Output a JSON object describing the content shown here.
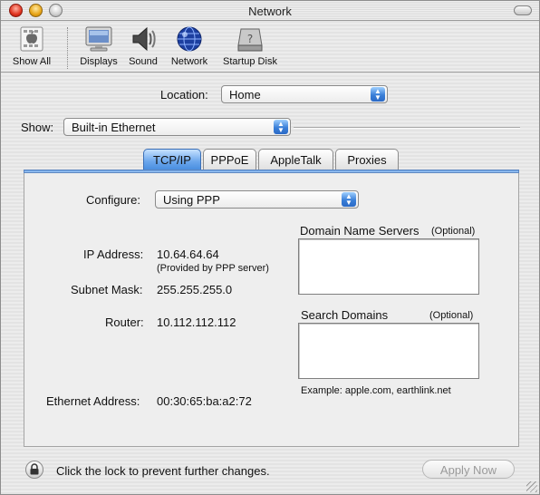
{
  "window": {
    "title": "Network"
  },
  "toolbar": {
    "items": [
      {
        "label": "Show All",
        "icon": "apple-show-all-icon"
      },
      {
        "label": "Displays",
        "icon": "display-monitor-icon"
      },
      {
        "label": "Sound",
        "icon": "speaker-icon"
      },
      {
        "label": "Network",
        "icon": "globe-icon"
      },
      {
        "label": "Startup Disk",
        "icon": "hard-disk-icon"
      }
    ]
  },
  "location": {
    "label": "Location:",
    "value": "Home"
  },
  "show": {
    "label": "Show:",
    "value": "Built-in Ethernet"
  },
  "tabs": [
    {
      "label": "TCP/IP",
      "active": true
    },
    {
      "label": "PPPoE",
      "active": false
    },
    {
      "label": "AppleTalk",
      "active": false
    },
    {
      "label": "Proxies",
      "active": false
    }
  ],
  "tcpip": {
    "configure_label": "Configure:",
    "configure_value": "Using PPP",
    "ip_label": "IP Address:",
    "ip_value": "10.64.64.64",
    "ip_note": "(Provided by PPP server)",
    "subnet_label": "Subnet Mask:",
    "subnet_value": "255.255.255.0",
    "router_label": "Router:",
    "router_value": "10.112.112.112",
    "ethernet_label": "Ethernet Address:",
    "ethernet_value": "00:30:65:ba:a2:72",
    "dns_label": "Domain Name Servers",
    "dns_optional": "(Optional)",
    "dns_value": "",
    "search_label": "Search Domains",
    "search_optional": "(Optional)",
    "search_value": "",
    "example": "Example: apple.com, earthlink.net"
  },
  "footer": {
    "lock_text": "Click the lock to prevent further changes.",
    "apply_label": "Apply Now"
  },
  "colors": {
    "accent": "#3a7fd8",
    "tab_active": "#6aa6ec"
  }
}
